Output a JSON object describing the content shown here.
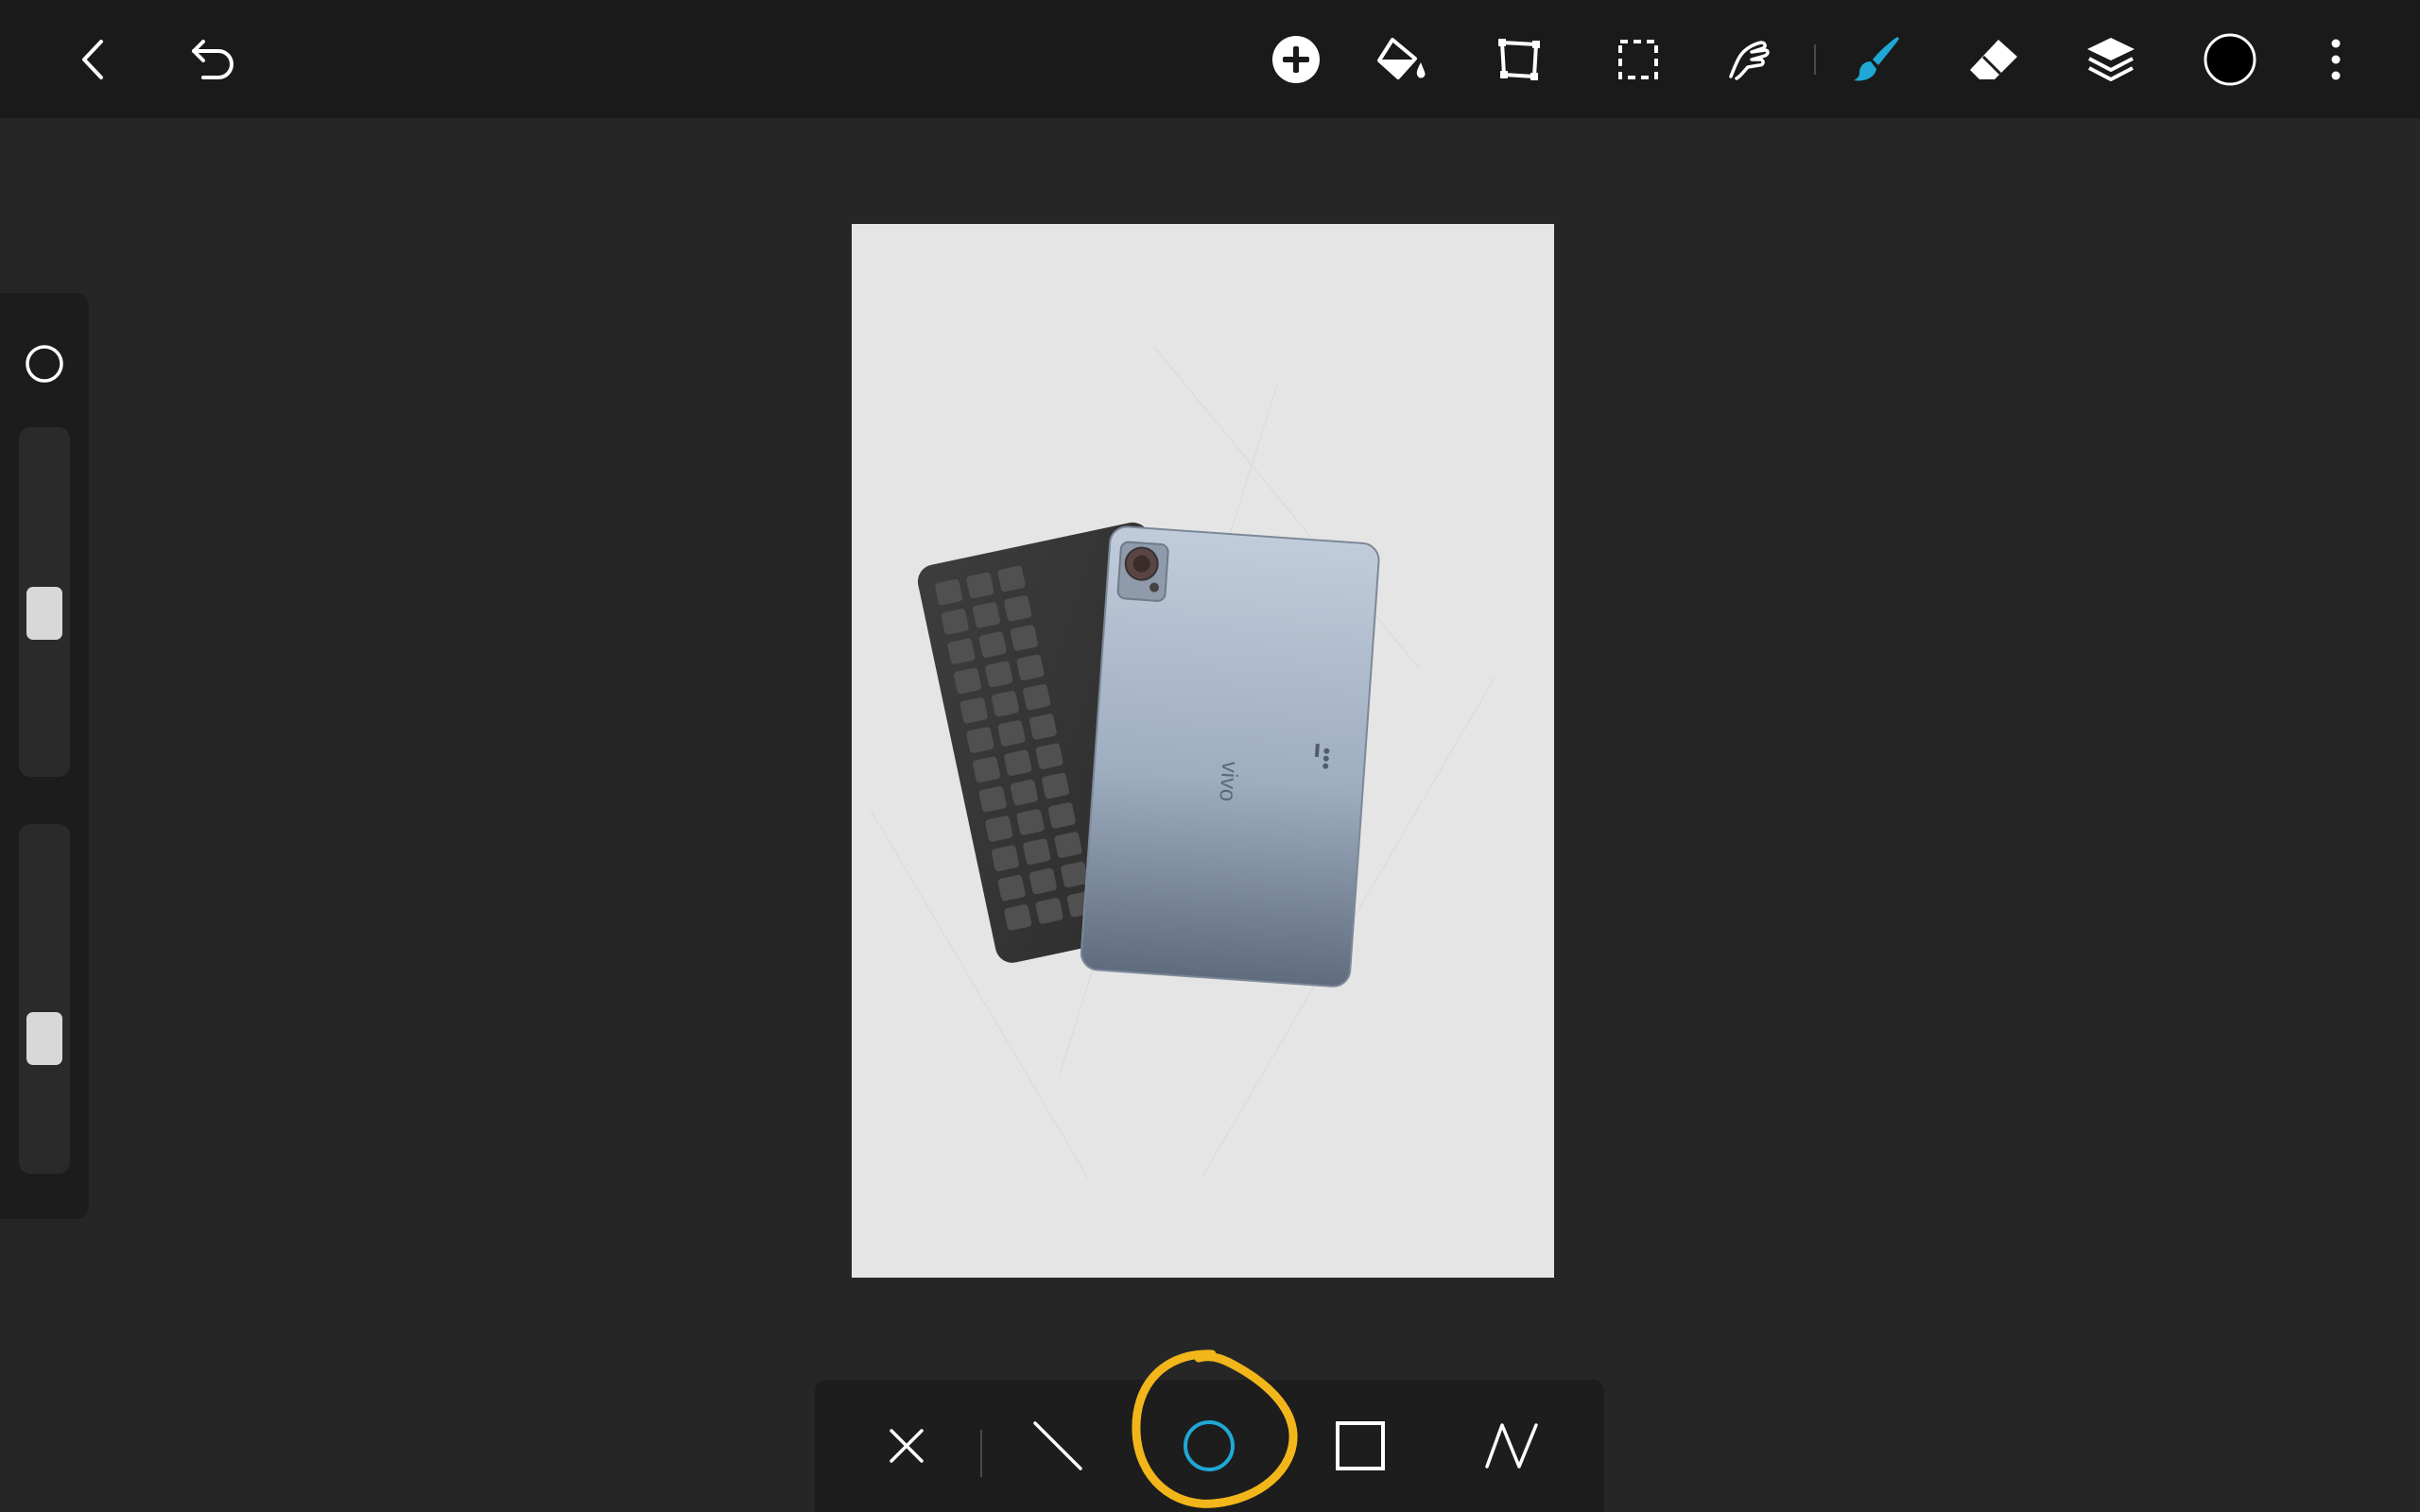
{
  "topbar": {
    "back_icon": "chevron-left-icon",
    "undo_icon": "undo-icon",
    "tools": [
      "add-circle-icon",
      "paint-bucket-icon",
      "transform-icon",
      "selection-icon",
      "smudge-icon",
      "brush-icon",
      "eraser-icon",
      "layers-icon",
      "color-swatch-icon",
      "more-vertical-icon"
    ],
    "active_tool": "brush-icon",
    "accent_color": "#1fa8d6",
    "current_color": "#000000"
  },
  "left_panel": {
    "brush_shape_icon": "circle-outline-icon",
    "size_slider_level": 0.46,
    "opacity_slider_level": 0.36
  },
  "canvas": {
    "background_color": "#e5e5e5",
    "image_subject": "tablet-with-keyboard",
    "tablet_brand_text": "vivo"
  },
  "shape_bar": {
    "items": [
      "close-icon",
      "line-icon",
      "circle-icon",
      "rectangle-icon",
      "polyline-icon"
    ],
    "selected": "circle-icon",
    "selected_color": "#1fa8d6",
    "highlight_color": "#f2b61b"
  }
}
